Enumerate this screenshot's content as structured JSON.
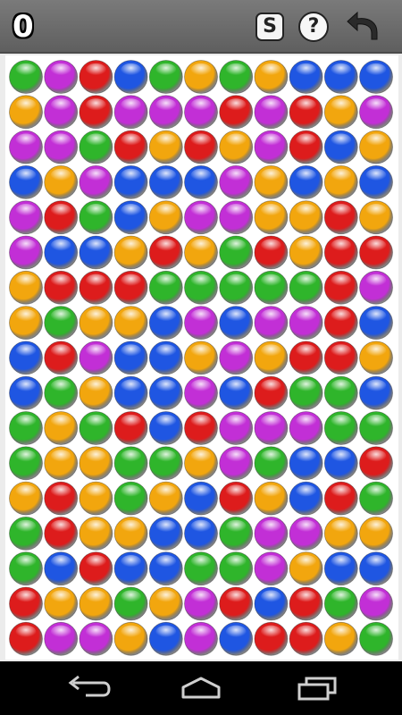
{
  "score": "0",
  "toolbar": {
    "shuffle_label": "S",
    "help_label": "?",
    "undo_icon": "undo-arrow-icon",
    "shuffle_icon": "shuffle-icon",
    "help_icon": "help-icon"
  },
  "navigation": {
    "back_icon": "back-icon",
    "home_icon": "home-icon",
    "recent_apps_icon": "recent-apps-icon"
  },
  "colors": {
    "G": "#2fb52b",
    "P": "#c22fd6",
    "R": "#dd1c1c",
    "B": "#1f56e2",
    "O": "#f2a60e"
  },
  "board": [
    [
      "G",
      "P",
      "R",
      "B",
      "G",
      "O",
      "G",
      "O",
      "B",
      "B",
      "B"
    ],
    [
      "O",
      "P",
      "R",
      "P",
      "P",
      "P",
      "R",
      "P",
      "R",
      "O",
      "P"
    ],
    [
      "P",
      "P",
      "G",
      "R",
      "O",
      "R",
      "O",
      "P",
      "R",
      "B",
      "O"
    ],
    [
      "B",
      "O",
      "P",
      "B",
      "B",
      "B",
      "P",
      "O",
      "B",
      "O",
      "B"
    ],
    [
      "P",
      "R",
      "G",
      "B",
      "O",
      "P",
      "P",
      "O",
      "O",
      "R",
      "O"
    ],
    [
      "P",
      "B",
      "B",
      "O",
      "R",
      "O",
      "G",
      "R",
      "O",
      "R",
      "R"
    ],
    [
      "O",
      "R",
      "R",
      "R",
      "G",
      "G",
      "G",
      "G",
      "G",
      "R",
      "P"
    ],
    [
      "O",
      "G",
      "O",
      "O",
      "B",
      "P",
      "B",
      "P",
      "P",
      "R",
      "B"
    ],
    [
      "B",
      "R",
      "P",
      "B",
      "B",
      "O",
      "P",
      "O",
      "R",
      "R",
      "O"
    ],
    [
      "B",
      "G",
      "O",
      "B",
      "B",
      "P",
      "B",
      "R",
      "G",
      "G",
      "B"
    ],
    [
      "G",
      "O",
      "G",
      "R",
      "B",
      "R",
      "P",
      "P",
      "P",
      "G",
      "G"
    ],
    [
      "G",
      "O",
      "O",
      "G",
      "G",
      "O",
      "P",
      "G",
      "B",
      "B",
      "R"
    ],
    [
      "O",
      "R",
      "O",
      "G",
      "O",
      "B",
      "R",
      "O",
      "B",
      "R",
      "G"
    ],
    [
      "G",
      "R",
      "O",
      "O",
      "B",
      "B",
      "G",
      "P",
      "P",
      "O",
      "O"
    ],
    [
      "G",
      "B",
      "R",
      "B",
      "B",
      "G",
      "G",
      "P",
      "O",
      "B",
      "B"
    ],
    [
      "R",
      "O",
      "O",
      "G",
      "O",
      "P",
      "R",
      "B",
      "R",
      "G",
      "P"
    ],
    [
      "R",
      "P",
      "P",
      "O",
      "B",
      "P",
      "B",
      "R",
      "R",
      "O",
      "G"
    ]
  ]
}
